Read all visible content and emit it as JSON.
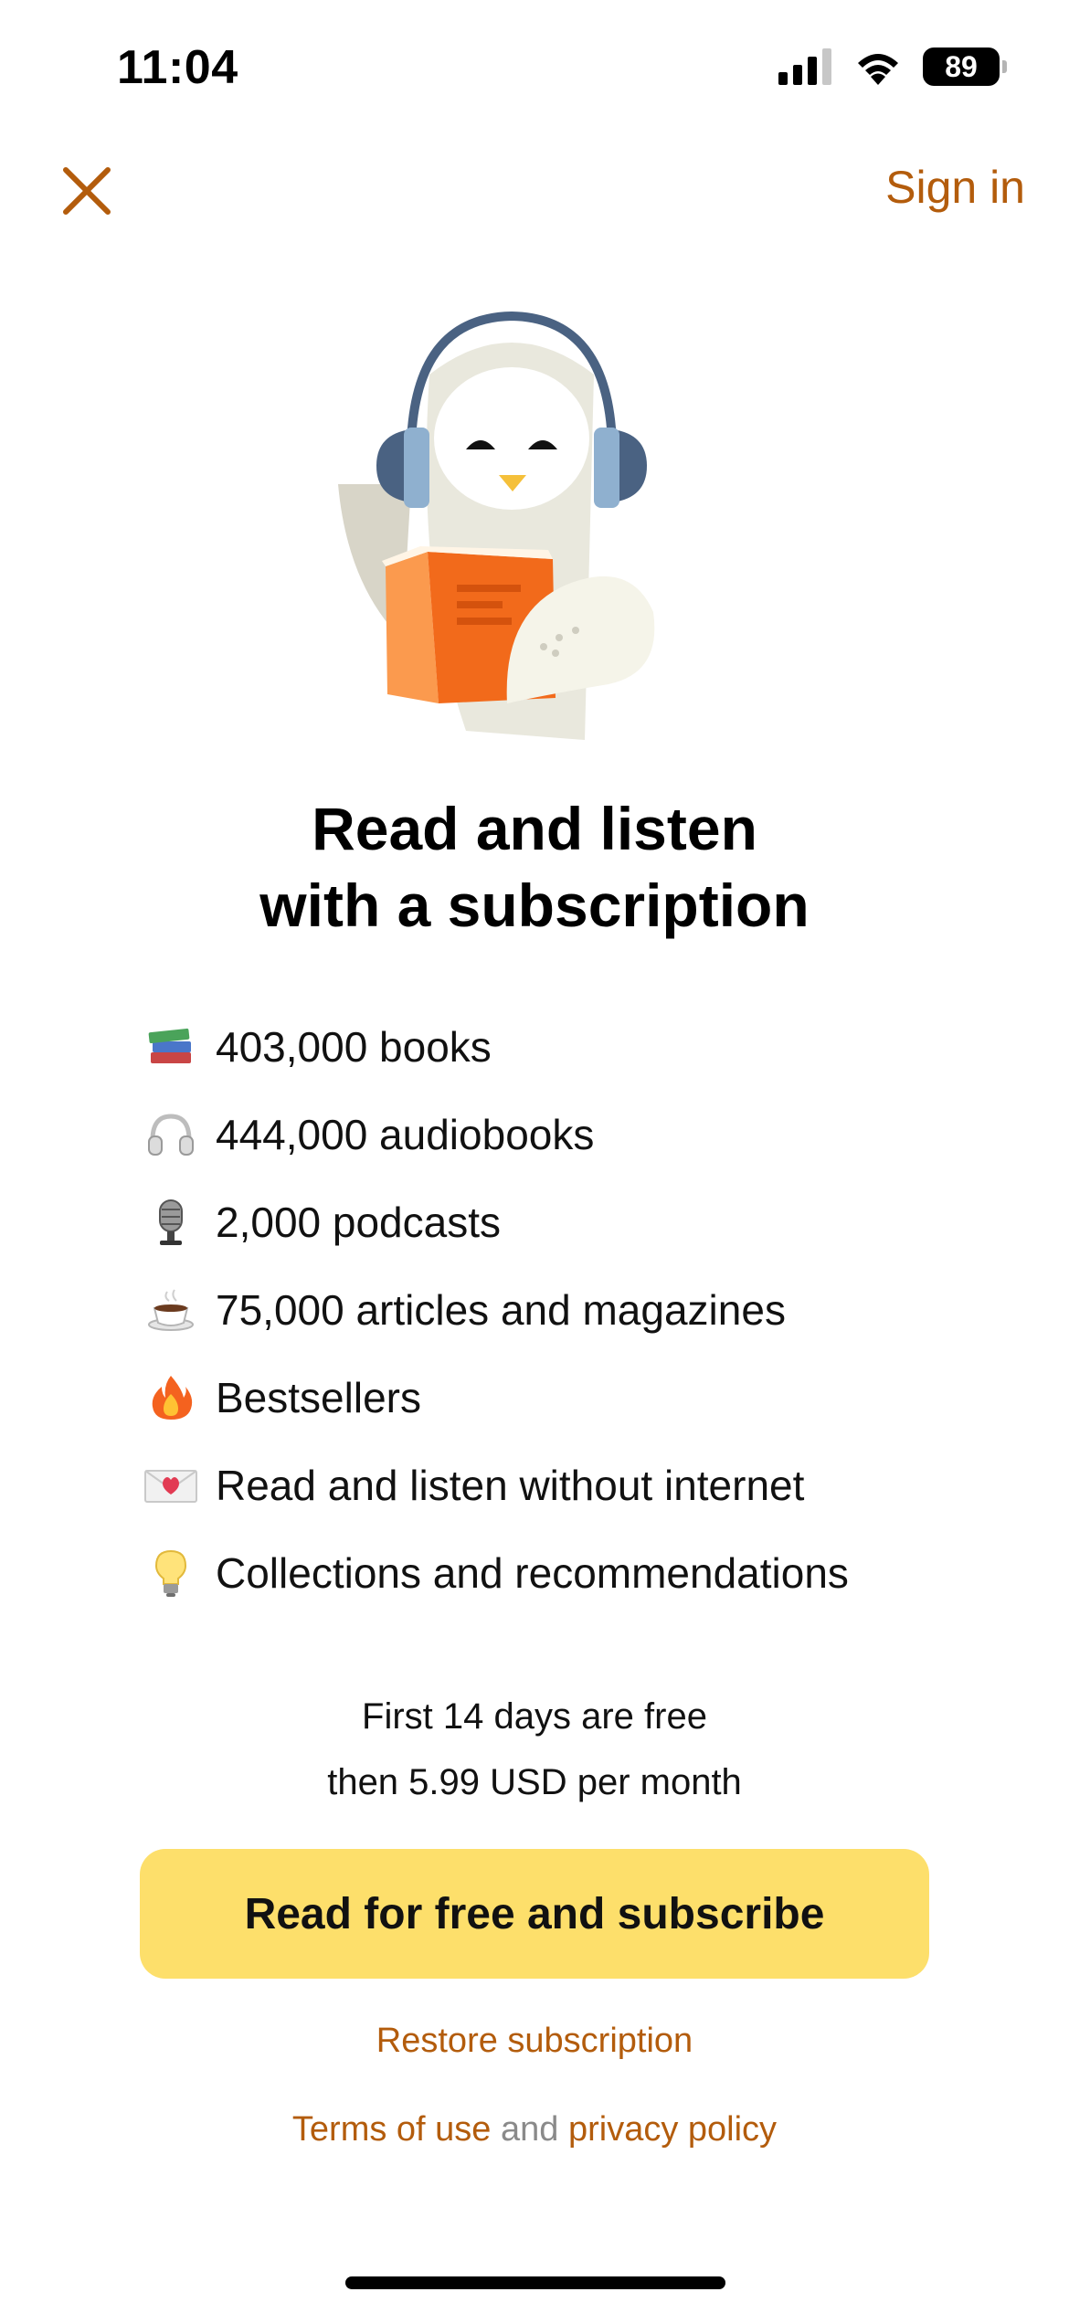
{
  "status_bar": {
    "time": "11:04",
    "battery_level": "89",
    "icons": [
      "cellular-signal-icon",
      "wifi-icon",
      "battery-icon"
    ]
  },
  "header": {
    "close_icon": "close-icon",
    "sign_in_label": "Sign in"
  },
  "illustration": {
    "subject": "owl-reading-book-with-headphones",
    "colors": {
      "headphones": "#4a6282",
      "ear_pads": "#8fb0cf",
      "book_cover": "#f26a1b",
      "book_back": "#fb9a4e",
      "owl_body": "#e9e8dd",
      "beak": "#f5c03a"
    }
  },
  "headline": {
    "line1": "Read and listen",
    "line2": "with a subscription"
  },
  "features": [
    {
      "icon": "books-icon",
      "label": "403,000 books"
    },
    {
      "icon": "headphones-icon",
      "label": "444,000 audiobooks"
    },
    {
      "icon": "microphone-icon",
      "label": "2,000 podcasts"
    },
    {
      "icon": "coffee-icon",
      "label": "75,000 articles and magazines"
    },
    {
      "icon": "fire-icon",
      "label": "Bestsellers"
    },
    {
      "icon": "love-letter-icon",
      "label": "Read and listen without internet"
    },
    {
      "icon": "light-bulb-icon",
      "label": "Collections and recommendations"
    }
  ],
  "pricing": {
    "line1": "First 14 days are free",
    "line2": "then 5.99 USD per month"
  },
  "cta": {
    "label": "Read for free and subscribe"
  },
  "links": {
    "restore": "Restore subscription",
    "terms": "Terms of use",
    "and": "and",
    "privacy": "privacy policy"
  },
  "colors": {
    "accent": "#b35c0c",
    "cta_background": "#fddf6b",
    "secondary_text": "#8a8a8a"
  }
}
